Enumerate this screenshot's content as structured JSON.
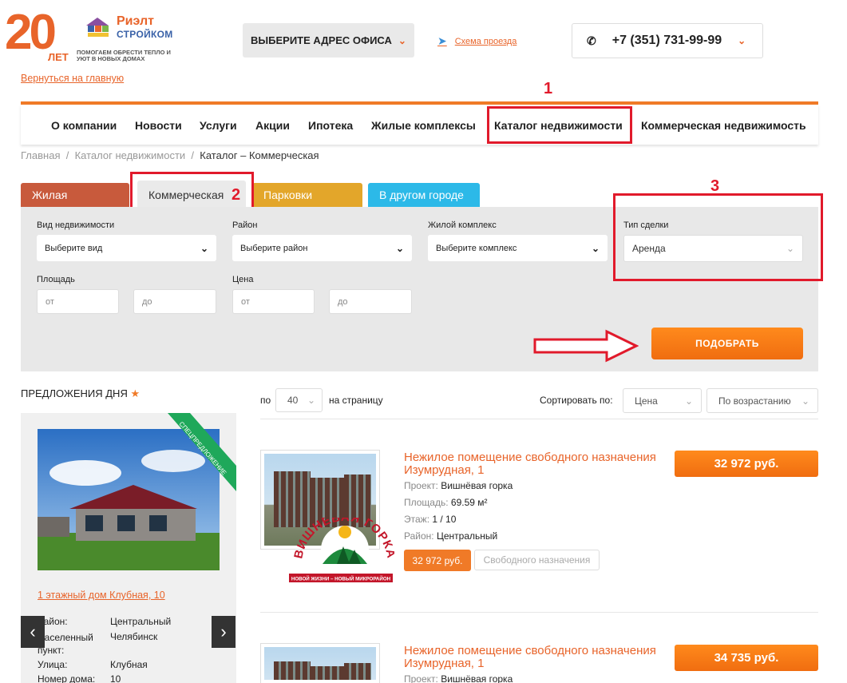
{
  "header": {
    "logo_number": "20",
    "logo_years": "ЛЕТ",
    "logo_brand_line1": "Риэлт",
    "logo_brand_line2": "СТРОЙКОМ",
    "logo_tagline": "ПОМОГАЕМ ОБРЕСТИ ТЕПЛО И УЮТ В НОВЫХ ДОМАХ",
    "office_button": "ВЫБЕРИТЕ АДРЕС ОФИСА",
    "route_link": "Схема проезда",
    "phone": "+7 (351) 731-99-99",
    "back_link": "Вернуться на главную",
    "brand_color": "#e8642a"
  },
  "nav": {
    "items": [
      "О компании",
      "Новости",
      "Услуги",
      "Акции",
      "Ипотека",
      "Жилые комплексы",
      "Каталог недвижимости",
      "Коммерческая недвижимость"
    ]
  },
  "annotations": [
    "1",
    "2",
    "3"
  ],
  "breadcrumb": [
    "Главная",
    "Каталог недвижимости",
    "Каталог – Коммерческая"
  ],
  "tabs": [
    "Жилая",
    "Коммерческая",
    "Парковки",
    "В другом городе"
  ],
  "filters": {
    "type_label": "Вид недвижимости",
    "type_value": "Выберите вид",
    "district_label": "Район",
    "district_value": "Выберите район",
    "complex_label": "Жилой комплекс",
    "complex_value": "Выберите комплекс",
    "deal_label": "Тип сделки",
    "deal_value": "Аренда",
    "area_label": "Площадь",
    "price_label": "Цена",
    "from_placeholder": "от",
    "to_placeholder": "до",
    "submit": "ПОДОБРАТЬ"
  },
  "offers": {
    "title": "ПРЕДЛОЖЕНИЯ ДНЯ",
    "ribbon": "СПЕЦПРЕДЛОЖЕНИЕ",
    "link": "1 этажный дом Клубная, 10",
    "rows": [
      {
        "k": "Район:",
        "v": "Центральный"
      },
      {
        "k": "Населенный пункт:",
        "v": "Челябинск"
      },
      {
        "k": "Улица:",
        "v": "Клубная"
      },
      {
        "k": "Номер дома:",
        "v": "10"
      }
    ]
  },
  "list_controls": {
    "po": "по",
    "per_page": "40",
    "per_page_label": "на страницу",
    "sort_label": "Сортировать по:",
    "sort_field": "Цена",
    "sort_order": "По возрастанию"
  },
  "listings": [
    {
      "title": "Нежилое помещение свободного назначения Изумрудная, 1",
      "project_k": "Проект:",
      "project_v": "Вишнёвая горка",
      "area_k": "Площадь:",
      "area_v": "69.59 м²",
      "floor_k": "Этаж:",
      "floor_v": "1 / 10",
      "district_k": "Район:",
      "district_v": "Центральный",
      "price": "32 972 руб.",
      "price_small": "32 972 руб.",
      "tag": "Свободного назначения",
      "emblem_text": "ВИШНЁВАЯ ГОРКА",
      "emblem_sub": "НОВОЙ ЖИЗНИ – НОВЫЙ МИКРОРАЙОН"
    },
    {
      "title": "Нежилое помещение свободного назначения Изумрудная, 1",
      "project_k": "Проект:",
      "project_v": "Вишнёвая горка",
      "price": "34 735 руб."
    }
  ]
}
